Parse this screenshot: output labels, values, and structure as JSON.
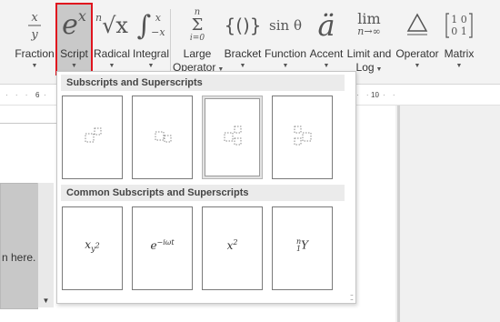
{
  "ribbon": {
    "fraction": {
      "label": "Fraction",
      "icon": "fraction-icon"
    },
    "script": {
      "label": "Script",
      "icon": "script-icon",
      "glyph": "e",
      "sup": "x"
    },
    "radical": {
      "label": "Radical",
      "icon": "radical-icon",
      "index": "n",
      "glyph": "√x"
    },
    "integral": {
      "label": "Integral",
      "icon": "integral-icon",
      "glyph": "∫",
      "upper": "x",
      "lower": "−x"
    },
    "large_operator": {
      "label_line1": "Large",
      "label_line2": "Operator",
      "icon": "summation-icon",
      "upper": "n",
      "glyph": "Σ",
      "lower": "i=0"
    },
    "bracket": {
      "label": "Bracket",
      "icon": "bracket-icon",
      "glyph": "{()}"
    },
    "function": {
      "label": "Function",
      "icon": "function-icon",
      "glyph": "sin θ"
    },
    "accent": {
      "label": "Accent",
      "icon": "accent-icon",
      "glyph": "ä"
    },
    "limit_and_log": {
      "label_line1": "Limit and",
      "label_line2": "Log",
      "icon": "limit-icon",
      "glyph": "lim",
      "sub": "n→∞"
    },
    "operator": {
      "label": "Operator",
      "icon": "operator-icon",
      "glyph": "Δ"
    },
    "matrix": {
      "label": "Matrix",
      "icon": "matrix-icon",
      "row1": "1 0",
      "row2": "0 1"
    }
  },
  "ruler": {
    "left_number": "6",
    "right_number": "10"
  },
  "document": {
    "gallery_text": "n here."
  },
  "dropdown": {
    "section1_title": "Subscripts and Superscripts",
    "section2_title": "Common Subscripts and Superscripts",
    "common": [
      {
        "name": "x-sub-y-squared",
        "base": "x",
        "sub": "y",
        "subsup": "2"
      },
      {
        "name": "e-minus-i-omega-t",
        "base": "e",
        "sup": "−iωt"
      },
      {
        "name": "x-squared",
        "base": "x",
        "sup": "2"
      },
      {
        "name": "n-1-y",
        "pre_sup": "n",
        "pre_sub": "1",
        "base": "Y"
      }
    ]
  },
  "colors": {
    "selection_outline": "#e0141e",
    "ribbon_bg": "#f3f3f3",
    "selected_button_bg": "#c9c9c9"
  }
}
